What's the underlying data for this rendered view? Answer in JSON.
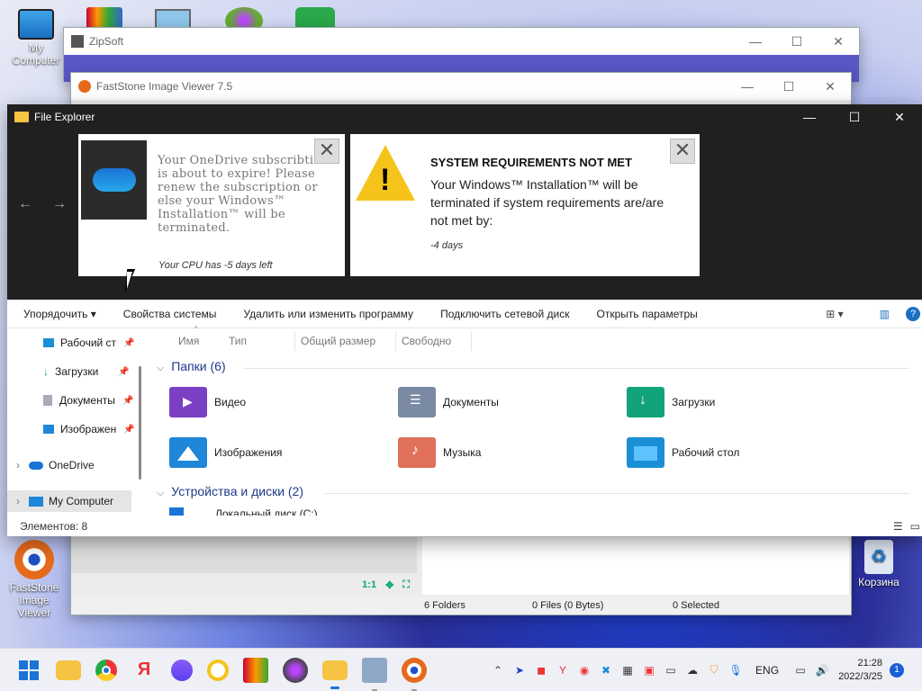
{
  "desktop": {
    "icons": [
      {
        "label": "My Computer"
      },
      {
        "label": "FastStone Image Viewer"
      },
      {
        "label": "Корзина"
      }
    ]
  },
  "zipsoft": {
    "title": "ZipSoft"
  },
  "faststone": {
    "title": "FastStone Image Viewer 7.5",
    "zoom_label": "1:1",
    "status": {
      "folders": "6 Folders",
      "files": "0 Files (0 Bytes)",
      "selected": "0 Selected"
    }
  },
  "explorer": {
    "title": "File Explorer",
    "window_controls": {
      "minimize": "—",
      "maximize": "☐",
      "close": "✕"
    },
    "nav_arrows": {
      "back": "←",
      "forward": "→"
    },
    "popup_onedrive": {
      "text": "Your OneDrive subscribtion is about to expire! Please renew the subscription or else your Windows™ Installation™ will be terminated.",
      "footer": "Your CPU has -5 days left",
      "close": "✕"
    },
    "popup_sysreq": {
      "heading": "SYSTEM REQUIREMENTS NOT MET",
      "body": "Your Windows™ Installation™ will be terminated if system requirements are/are not met by:",
      "days": "-4 days",
      "close": "✕"
    },
    "toolbar": {
      "organize": "Упорядочить",
      "system_props": "Свойства системы",
      "uninstall": "Удалить или изменить программу",
      "map_drive": "Подключить сетевой диск",
      "open_settings": "Открыть параметры"
    },
    "nav": [
      {
        "label": "Рабочий ст"
      },
      {
        "label": "Загрузки"
      },
      {
        "label": "Документы"
      },
      {
        "label": "Изображен"
      },
      {
        "label": "OneDrive"
      },
      {
        "label": "My Computer"
      }
    ],
    "columns": [
      "Имя",
      "Тип",
      "Общий размер",
      "Свободно"
    ],
    "group_folders": "Папки (6)",
    "group_drives": "Устройства и диски (2)",
    "folders": [
      {
        "label": "Видео",
        "color": "#7b3fc4"
      },
      {
        "label": "Документы",
        "color": "#7a8aa3"
      },
      {
        "label": "Загрузки",
        "color": "#13a37a"
      },
      {
        "label": "Изображения",
        "color": "#1f86d8"
      },
      {
        "label": "Музыка",
        "color": "#e0705a"
      },
      {
        "label": "Рабочий стол",
        "color": "#1a8fd6"
      }
    ],
    "drive_partial": "Локальный диск (С:)",
    "status_count": "Элементов: 8"
  },
  "taskbar": {
    "apps": [
      "start",
      "files",
      "chrome",
      "yandex",
      "alice",
      "browser",
      "winrar",
      "orb",
      "explorer",
      "installer",
      "faststone"
    ],
    "yandex_letter": "Я",
    "language": "ENG",
    "time": "21:28",
    "date": "2022/3/25",
    "notifications": "1"
  }
}
